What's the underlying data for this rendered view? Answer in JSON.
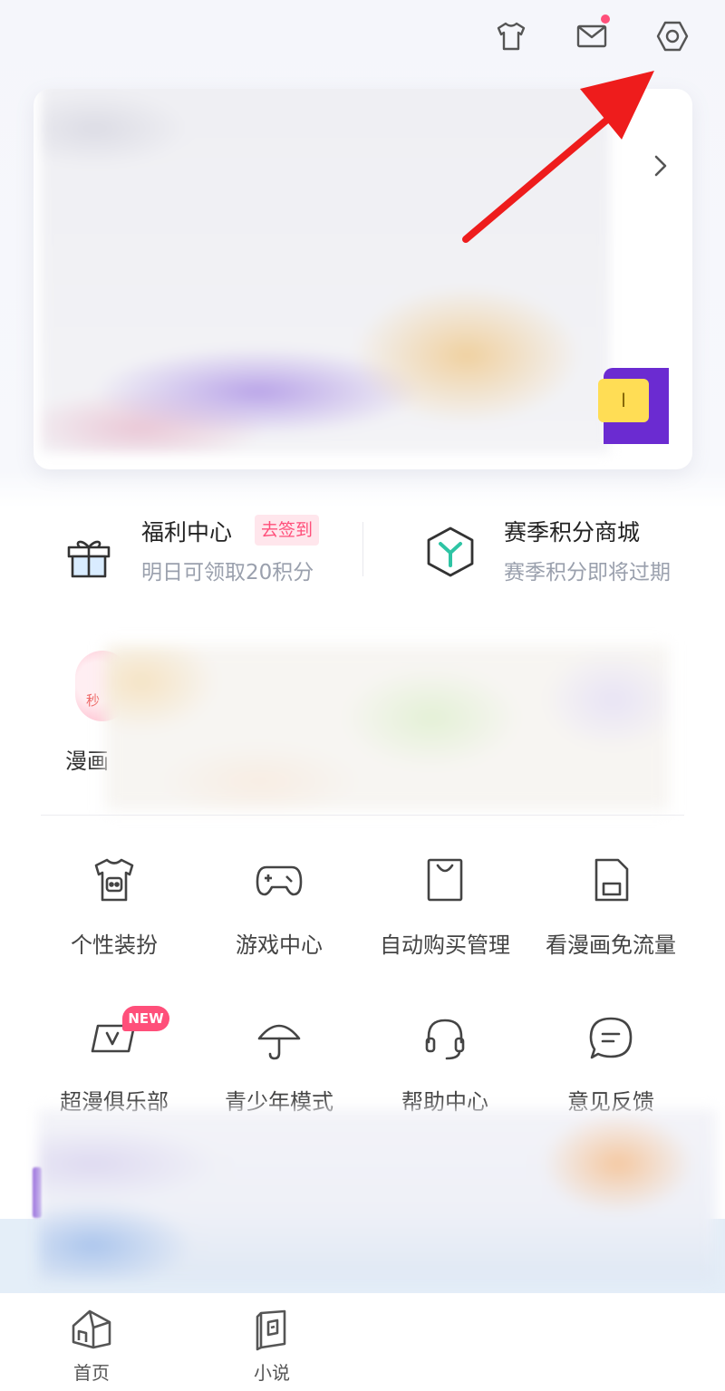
{
  "header": {
    "icons": [
      "tshirt-icon",
      "mail-icon",
      "settings-icon"
    ],
    "mail_has_dot": true
  },
  "profile_card": {
    "tab_text": "l"
  },
  "welfare": {
    "title": "福利中心",
    "badge": "去签到",
    "subtitle": "明日可领取20积分",
    "shop_title": "赛季积分商城",
    "shop_subtitle": "赛季积分即将过期"
  },
  "manga": {
    "label": "漫画",
    "avatar_text": "秒"
  },
  "grid": [
    {
      "label": "个性装扮",
      "icon": "shirt-icon"
    },
    {
      "label": "游戏中心",
      "icon": "gamepad-icon"
    },
    {
      "label": "自动购买管理",
      "icon": "shopping-bag-icon"
    },
    {
      "label": "看漫画免流量",
      "icon": "sim-card-icon"
    },
    {
      "label": "超漫俱乐部",
      "icon": "vip-card-icon",
      "badge": "NEW"
    },
    {
      "label": "青少年模式",
      "icon": "umbrella-icon"
    },
    {
      "label": "帮助中心",
      "icon": "headset-icon"
    },
    {
      "label": "意见反馈",
      "icon": "feedback-icon"
    }
  ],
  "tabbar": [
    {
      "label": "首页",
      "icon": "home-icon"
    },
    {
      "label": "小说",
      "icon": "book-icon"
    }
  ],
  "colors": {
    "accent_pink": "#ff4f7a",
    "arrow_red": "#ee1c1c",
    "purple": "#6b2bd1",
    "text_secondary": "#9aa0ad"
  }
}
